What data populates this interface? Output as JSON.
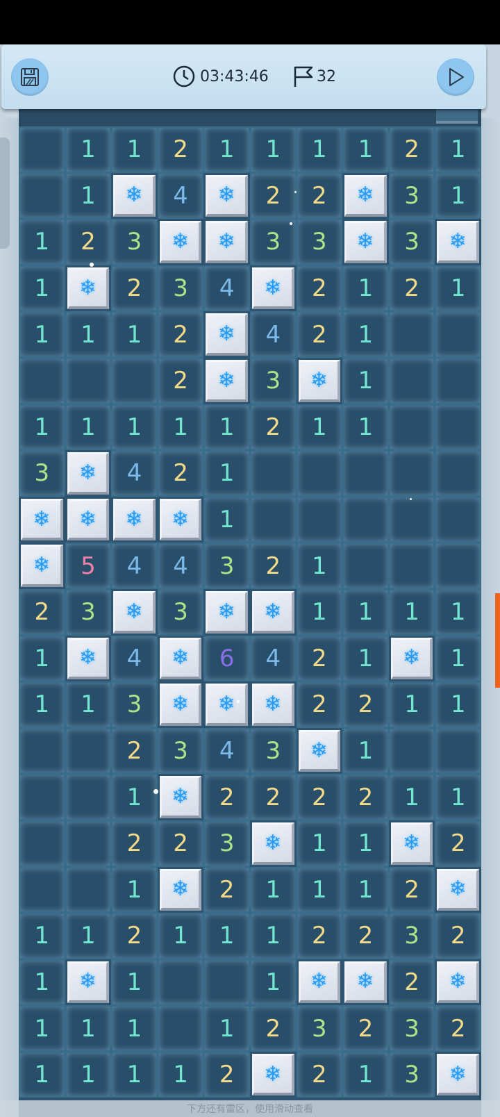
{
  "toolbar": {
    "timer": "03:43:46",
    "flags": "32",
    "save_icon": "save-icon",
    "timer_icon": "clock-icon",
    "flag_icon": "flag-icon",
    "play_icon": "play-icon"
  },
  "hint": "下方还有雷区，使用滑动查看",
  "board": {
    "columns": 10,
    "mine_icon": "snowflake-icon",
    "mine_glyph": "❄",
    "rows": [
      [
        "",
        "1",
        "1",
        "2",
        "1",
        "1",
        "1",
        "1",
        "2",
        "1"
      ],
      [
        "",
        "1",
        "M",
        "4",
        "M",
        "2",
        "2",
        "M",
        "3",
        "1"
      ],
      [
        "1",
        "2",
        "3",
        "M",
        "M",
        "3",
        "3",
        "M",
        "3",
        "M"
      ],
      [
        "1",
        "M",
        "2",
        "3",
        "4",
        "M",
        "2",
        "1",
        "2",
        "1"
      ],
      [
        "1",
        "1",
        "1",
        "2",
        "M",
        "4",
        "2",
        "1",
        "",
        ""
      ],
      [
        "",
        "",
        "",
        "2",
        "M",
        "3",
        "M",
        "1",
        "",
        ""
      ],
      [
        "1",
        "1",
        "1",
        "1",
        "1",
        "2",
        "1",
        "1",
        "",
        ""
      ],
      [
        "3",
        "M",
        "4",
        "2",
        "1",
        "",
        "",
        "",
        "",
        ""
      ],
      [
        "M",
        "M",
        "M",
        "M",
        "1",
        "",
        "",
        "",
        "",
        ""
      ],
      [
        "M",
        "5",
        "4",
        "4",
        "3",
        "2",
        "1",
        "",
        "",
        ""
      ],
      [
        "2",
        "3",
        "M",
        "3",
        "M",
        "M",
        "1",
        "1",
        "1",
        "1"
      ],
      [
        "1",
        "M",
        "4",
        "M",
        "6",
        "4",
        "2",
        "1",
        "M",
        "1"
      ],
      [
        "1",
        "1",
        "3",
        "M",
        "M",
        "M",
        "2",
        "2",
        "1",
        "1"
      ],
      [
        "",
        "",
        "2",
        "3",
        "4",
        "3",
        "M",
        "1",
        "",
        ""
      ],
      [
        "",
        "",
        "1",
        "M",
        "2",
        "2",
        "2",
        "2",
        "1",
        "1"
      ],
      [
        "",
        "",
        "2",
        "2",
        "3",
        "M",
        "1",
        "1",
        "M",
        "2"
      ],
      [
        "",
        "",
        "1",
        "M",
        "2",
        "1",
        "1",
        "1",
        "2",
        "M"
      ],
      [
        "1",
        "1",
        "2",
        "1",
        "1",
        "1",
        "2",
        "2",
        "3",
        "2"
      ],
      [
        "1",
        "M",
        "1",
        "",
        "",
        "1",
        "M",
        "M",
        "2",
        "M"
      ],
      [
        "1",
        "1",
        "1",
        "",
        "1",
        "2",
        "3",
        "2",
        "3",
        "2"
      ],
      [
        "1",
        "1",
        "1",
        "1",
        "2",
        "M",
        "2",
        "1",
        "3",
        "M"
      ]
    ]
  }
}
